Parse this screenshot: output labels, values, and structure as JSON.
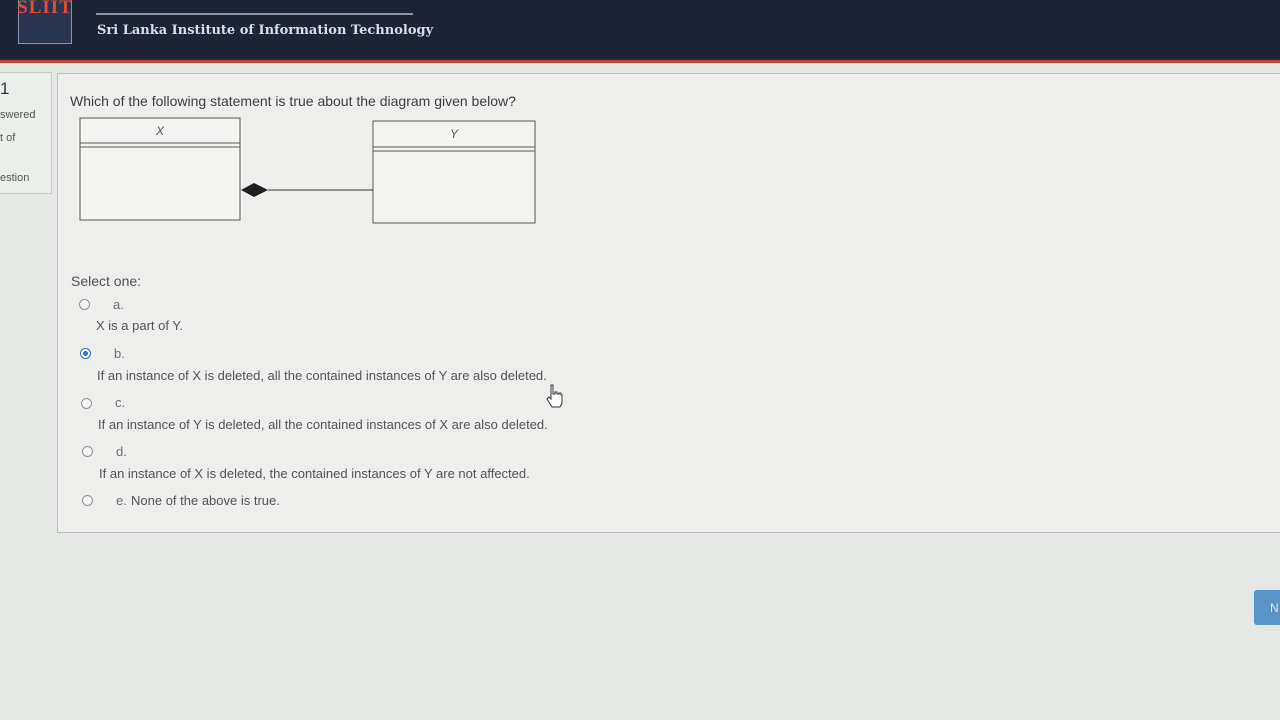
{
  "header": {
    "logo_text": "SLIIT",
    "institute_name": "Sri Lanka Institute of Information Technology"
  },
  "question_info": {
    "number": "1",
    "status_line": "swered",
    "marks_line": "t of",
    "flag_line": "estion"
  },
  "question": {
    "text": "Which of the following statement is true about the diagram given below?",
    "diagram": {
      "class_left": "X",
      "class_right": "Y",
      "relationship": "composition"
    },
    "select_label": "Select one:",
    "options": [
      {
        "letter": "a.",
        "text": "X is a part of Y.",
        "selected": false
      },
      {
        "letter": "b.",
        "text": "If an instance of X is deleted, all the contained instances of Y are also deleted.",
        "selected": true
      },
      {
        "letter": "c.",
        "text": "If an instance of Y is deleted, all the contained instances of X are also deleted.",
        "selected": false
      },
      {
        "letter": "d.",
        "text": "If an instance of X is deleted, the contained instances of Y are not affected.",
        "selected": false
      },
      {
        "letter": "e.",
        "text": "None of the above is true.",
        "selected": false
      }
    ]
  },
  "navigation": {
    "next_label": "N"
  },
  "colors": {
    "header_bg": "#1d2535",
    "header_border": "#c8423a",
    "radio_selected": "#2f6fd6",
    "next_button": "#5b95c7"
  }
}
